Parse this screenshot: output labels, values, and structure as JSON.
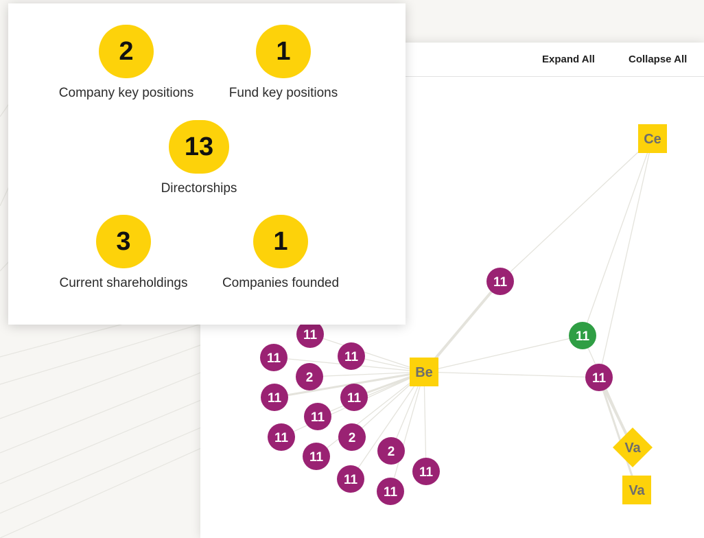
{
  "toolbar": {
    "expand_all_label": "Expand All",
    "collapse_all_label": "Collapse All"
  },
  "stats": {
    "company_key_positions": {
      "count": "2",
      "label": "Company key positions"
    },
    "fund_key_positions": {
      "count": "1",
      "label": "Fund key positions"
    },
    "directorships": {
      "count": "13",
      "label": "Directorships"
    },
    "current_shareholdings": {
      "count": "3",
      "label": "Current shareholdings"
    },
    "companies_founded": {
      "count": "1",
      "label": "Companies founded"
    }
  },
  "graph": {
    "nodes": [
      {
        "id": "be",
        "label": "Be",
        "shape": "square",
        "color": "#fdd20a"
      },
      {
        "id": "ce",
        "label": "Ce",
        "shape": "square",
        "color": "#fdd20a"
      },
      {
        "id": "va1",
        "label": "Va",
        "shape": "diamond",
        "color": "#fdd20a"
      },
      {
        "id": "va2",
        "label": "Va",
        "shape": "square",
        "color": "#fdd20a"
      },
      {
        "id": "g1",
        "label": "11",
        "shape": "circle",
        "color": "#2f9e44"
      },
      {
        "id": "p-top",
        "label": "11",
        "shape": "circle",
        "color": "#9a2273"
      },
      {
        "id": "p-right",
        "label": "11",
        "shape": "circle",
        "color": "#9a2273"
      },
      {
        "id": "p1",
        "label": "11",
        "shape": "circle",
        "color": "#9a2273"
      },
      {
        "id": "p2",
        "label": "11",
        "shape": "circle",
        "color": "#9a2273"
      },
      {
        "id": "p3",
        "label": "11",
        "shape": "circle",
        "color": "#9a2273"
      },
      {
        "id": "p4",
        "label": "2",
        "shape": "circle",
        "color": "#9a2273"
      },
      {
        "id": "p5",
        "label": "11",
        "shape": "circle",
        "color": "#9a2273"
      },
      {
        "id": "p6",
        "label": "11",
        "shape": "circle",
        "color": "#9a2273"
      },
      {
        "id": "p7",
        "label": "11",
        "shape": "circle",
        "color": "#9a2273"
      },
      {
        "id": "p8",
        "label": "11",
        "shape": "circle",
        "color": "#9a2273"
      },
      {
        "id": "p9",
        "label": "2",
        "shape": "circle",
        "color": "#9a2273"
      },
      {
        "id": "p10",
        "label": "11",
        "shape": "circle",
        "color": "#9a2273"
      },
      {
        "id": "p11",
        "label": "2",
        "shape": "circle",
        "color": "#9a2273"
      },
      {
        "id": "p12",
        "label": "11",
        "shape": "circle",
        "color": "#9a2273"
      },
      {
        "id": "p13",
        "label": "11",
        "shape": "circle",
        "color": "#9a2273"
      },
      {
        "id": "p14",
        "label": "11",
        "shape": "circle",
        "color": "#9a2273"
      }
    ],
    "edges": [
      [
        "be",
        "p-top"
      ],
      [
        "p-top",
        "ce"
      ],
      [
        "be",
        "g1"
      ],
      [
        "be",
        "p-right"
      ],
      [
        "g1",
        "ce"
      ],
      [
        "p-right",
        "ce"
      ],
      [
        "p-right",
        "va1"
      ],
      [
        "p-right",
        "va2"
      ],
      [
        "g1",
        "va1"
      ],
      [
        "be",
        "p1"
      ],
      [
        "be",
        "p2"
      ],
      [
        "be",
        "p3"
      ],
      [
        "be",
        "p4"
      ],
      [
        "be",
        "p5"
      ],
      [
        "be",
        "p6"
      ],
      [
        "be",
        "p7"
      ],
      [
        "be",
        "p8"
      ],
      [
        "be",
        "p9"
      ],
      [
        "be",
        "p10"
      ],
      [
        "be",
        "p11"
      ],
      [
        "be",
        "p12"
      ],
      [
        "be",
        "p13"
      ],
      [
        "be",
        "p14"
      ]
    ]
  }
}
